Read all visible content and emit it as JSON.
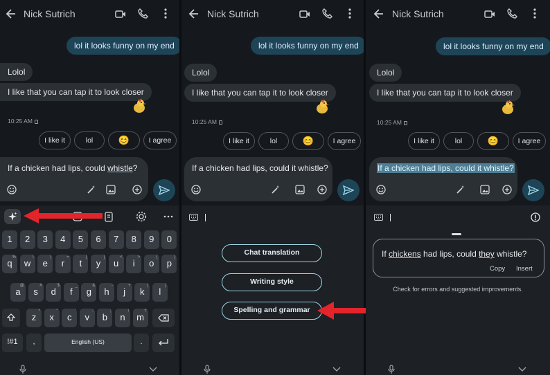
{
  "contact_name": "Nick Sutrich",
  "messages": {
    "outgoing": "lol it looks funny on my end",
    "incoming_1": "Lolol",
    "incoming_2": "I like that you can tap it to look closer",
    "timestamp": "10:25 AM"
  },
  "smart_replies": [
    "I like it",
    "lol",
    "😊",
    "I agree"
  ],
  "compose": {
    "draft_prefix": "If a chicken had lips, could ",
    "draft_underlined": "whistle",
    "draft_suffix": "?",
    "draft_full": "If a chicken had lips, could it whistle?"
  },
  "keyboard": {
    "number_row": [
      "1",
      "2",
      "3",
      "4",
      "5",
      "6",
      "7",
      "8",
      "9",
      "0"
    ],
    "row1": [
      {
        "k": "q",
        "s": "%"
      },
      {
        "k": "w",
        "s": "\\"
      },
      {
        "k": "e",
        "s": "|"
      },
      {
        "k": "r",
        "s": "="
      },
      {
        "k": "t",
        "s": "["
      },
      {
        "k": "y",
        "s": "]"
      },
      {
        "k": "u",
        "s": "<"
      },
      {
        "k": "i",
        "s": ">"
      },
      {
        "k": "o",
        "s": "{"
      },
      {
        "k": "p",
        "s": "}"
      }
    ],
    "row2": [
      {
        "k": "a",
        "s": "@"
      },
      {
        "k": "s",
        "s": "#"
      },
      {
        "k": "d",
        "s": "$"
      },
      {
        "k": "f",
        "s": "_"
      },
      {
        "k": "g",
        "s": "&"
      },
      {
        "k": "h",
        "s": "-"
      },
      {
        "k": "j",
        "s": "+"
      },
      {
        "k": "k",
        "s": "("
      },
      {
        "k": "l",
        "s": ")"
      }
    ],
    "row3": [
      {
        "k": "z",
        "s": "*"
      },
      {
        "k": "x",
        "s": "\""
      },
      {
        "k": "c",
        "s": "'"
      },
      {
        "k": "v",
        "s": ":"
      },
      {
        "k": "b",
        "s": ";"
      },
      {
        "k": "n",
        "s": "!"
      },
      {
        "k": "m",
        "s": "?"
      }
    ],
    "symbols": "!#1",
    "comma": ",",
    "space": "English (US)",
    "period": "."
  },
  "ai_options": {
    "chat_translation": "Chat translation",
    "writing_style": "Writing style",
    "spelling_grammar": "Spelling and grammar"
  },
  "suggestion": {
    "pre1": "If ",
    "fix1": "chickens",
    "mid": " had lips, could ",
    "fix2": "they",
    "post": " whistle?",
    "copy": "Copy",
    "insert": "Insert",
    "note": "Check for errors and suggested improvements."
  },
  "colors": {
    "outgoing_bubble": "#1e4457",
    "incoming_bubble": "#2b3035",
    "accent": "#9ed6e6",
    "annotation_arrow": "#e3242b"
  },
  "icons": [
    "back-arrow-icon",
    "video-call-icon",
    "phone-icon",
    "more-vert-icon",
    "sparkle-icon",
    "emoji-icon",
    "magic-wand-icon",
    "image-icon",
    "add-icon",
    "send-icon",
    "clipboard-icon",
    "settings-icon",
    "more-horiz-icon",
    "keyboard-icon",
    "info-icon",
    "mic-icon",
    "chevron-down-icon",
    "backspace-icon",
    "shift-icon",
    "enter-icon"
  ]
}
